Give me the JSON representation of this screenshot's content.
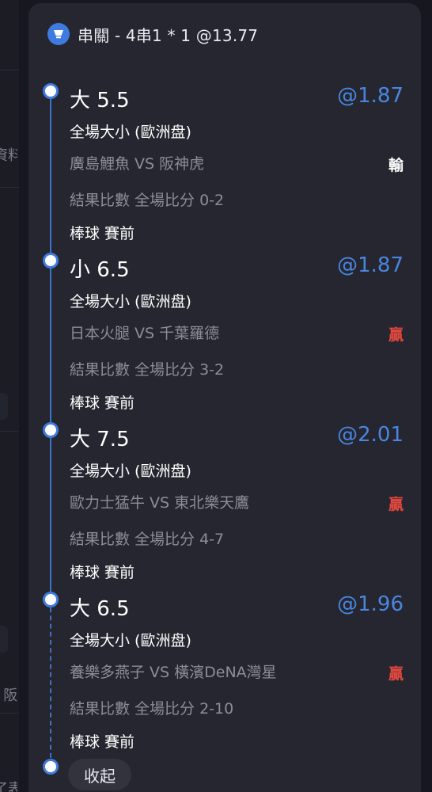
{
  "background": {
    "fragments": [
      "資料",
      "- 阪",
      "了表"
    ]
  },
  "header": {
    "icon": "parlay-cup-icon",
    "title": "串關 - 4串1 * 1 @13.77"
  },
  "colors": {
    "accent": "#4a86e0",
    "win": "#e2483d",
    "lose": "#ffffff",
    "card": "#25262f"
  },
  "bets": [
    {
      "selection": "大 5.5",
      "odds": "@1.87",
      "market": "全場大小 (歐洲盘)",
      "match": "廣島鯉魚 VS 阪神虎",
      "result": "輸",
      "result_type": "lose",
      "score": "結果比數 全場比分 0-2",
      "sport": "棒球 賽前"
    },
    {
      "selection": "小 6.5",
      "odds": "@1.87",
      "market": "全場大小 (歐洲盘)",
      "match": "日本火腿 VS 千葉羅德",
      "result": "贏",
      "result_type": "win",
      "score": "結果比數 全場比分 3-2",
      "sport": "棒球 賽前"
    },
    {
      "selection": "大 7.5",
      "odds": "@2.01",
      "market": "全場大小 (歐洲盘)",
      "match": "歐力士猛牛 VS 東北樂天鷹",
      "result": "贏",
      "result_type": "win",
      "score": "結果比數 全場比分 4-7",
      "sport": "棒球 賽前"
    },
    {
      "selection": "大 6.5",
      "odds": "@1.96",
      "market": "全場大小 (歐洲盘)",
      "match": "養樂多燕子 VS 橫濱DeNA灣星",
      "result": "贏",
      "result_type": "win",
      "score": "結果比數 全場比分 2-10",
      "sport": "棒球 賽前"
    }
  ],
  "collapse_label": "收起"
}
